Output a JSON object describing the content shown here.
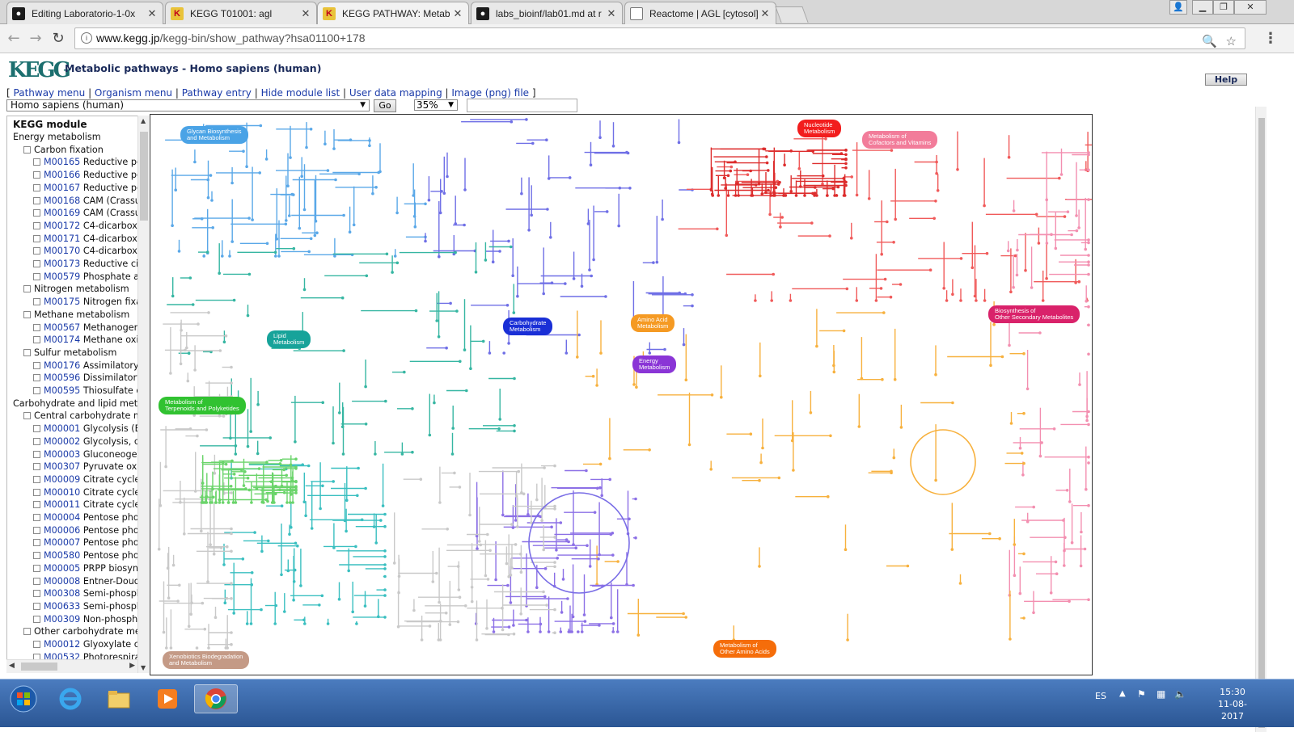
{
  "browser": {
    "tabs": [
      {
        "title": "Editing Laboratorio-1-0x",
        "icon": "github-icon"
      },
      {
        "title": "KEGG T01001: agl",
        "icon": "kegg-icon"
      },
      {
        "title": "KEGG PATHWAY: Metab",
        "icon": "kegg-icon",
        "active": true
      },
      {
        "title": "labs_bioinf/lab01.md at r",
        "icon": "github-icon"
      },
      {
        "title": "Reactome | AGL [cytosol]",
        "icon": "document-icon"
      }
    ],
    "url_host": "www.kegg.jp",
    "url_path": "/kegg-bin/show_pathway?hsa01100+178"
  },
  "page": {
    "title": "Metabolic pathways - Homo sapiens (human)",
    "logo_text": "KEGG",
    "menu_open": "[",
    "menu_links": [
      "Pathway menu",
      "Organism menu",
      "Pathway entry",
      "Hide module list",
      "User data mapping",
      "Image (png) file"
    ],
    "menu_close": "]",
    "help": "Help",
    "organism": "Homo sapiens (human)",
    "go": "Go",
    "zoom": "35%",
    "search_value": ""
  },
  "modules": {
    "header": "KEGG module",
    "items": [
      {
        "text": "Energy metabolism",
        "level": 0
      },
      {
        "text": "Carbon fixation",
        "level": 1
      },
      {
        "code": "M00165",
        "text": "Reductive pe",
        "level": 2
      },
      {
        "code": "M00166",
        "text": "Reductive pe",
        "level": 2
      },
      {
        "code": "M00167",
        "text": "Reductive pe",
        "level": 2
      },
      {
        "code": "M00168",
        "text": "CAM (Crassul",
        "level": 2
      },
      {
        "code": "M00169",
        "text": "CAM (Crassul",
        "level": 2
      },
      {
        "code": "M00172",
        "text": "C4-dicarboxy",
        "level": 2
      },
      {
        "code": "M00171",
        "text": "C4-dicarboxy",
        "level": 2
      },
      {
        "code": "M00170",
        "text": "C4-dicarboxy",
        "level": 2
      },
      {
        "code": "M00173",
        "text": "Reductive cit",
        "level": 2
      },
      {
        "code": "M00579",
        "text": "Phosphate ac",
        "level": 2
      },
      {
        "text": "Nitrogen metabolism",
        "level": 1
      },
      {
        "code": "M00175",
        "text": "Nitrogen fixat",
        "level": 2
      },
      {
        "text": "Methane metabolism",
        "level": 1
      },
      {
        "code": "M00567",
        "text": "Methanogene",
        "level": 2
      },
      {
        "code": "M00174",
        "text": "Methane oxid",
        "level": 2
      },
      {
        "text": "Sulfur metabolism",
        "level": 1
      },
      {
        "code": "M00176",
        "text": "Assimilatory :",
        "level": 2
      },
      {
        "code": "M00596",
        "text": "Dissimilatory",
        "level": 2
      },
      {
        "code": "M00595",
        "text": "Thiosulfate o:",
        "level": 2
      },
      {
        "text": "Carbohydrate and lipid metal",
        "level": 0
      },
      {
        "text": "Central carbohydrate m",
        "level": 1
      },
      {
        "code": "M00001",
        "text": "Glycolysis (Er",
        "level": 2
      },
      {
        "code": "M00002",
        "text": "Glycolysis, cc",
        "level": 2
      },
      {
        "code": "M00003",
        "text": "Gluconeogen",
        "level": 2
      },
      {
        "code": "M00307",
        "text": "Pyruvate oxic",
        "level": 2
      },
      {
        "code": "M00009",
        "text": "Citrate cycle",
        "level": 2
      },
      {
        "code": "M00010",
        "text": "Citrate cycle,",
        "level": 2
      },
      {
        "code": "M00011",
        "text": "Citrate cycle,",
        "level": 2
      },
      {
        "code": "M00004",
        "text": "Pentose phos",
        "level": 2
      },
      {
        "code": "M00006",
        "text": "Pentose phos",
        "level": 2
      },
      {
        "code": "M00007",
        "text": "Pentose phos",
        "level": 2
      },
      {
        "code": "M00580",
        "text": "Pentose phos",
        "level": 2
      },
      {
        "code": "M00005",
        "text": "PRPP biosyntl",
        "level": 2
      },
      {
        "code": "M00008",
        "text": "Entner-Doudc",
        "level": 2
      },
      {
        "code": "M00308",
        "text": "Semi-phosph",
        "level": 2
      },
      {
        "code": "M00633",
        "text": "Semi-phosph",
        "level": 2
      },
      {
        "code": "M00309",
        "text": "Non-phospho",
        "level": 2
      },
      {
        "text": "Other carbohydrate met",
        "level": 1
      },
      {
        "code": "M00012",
        "text": "Glyoxylate cy",
        "level": 2
      },
      {
        "code": "M00532",
        "text": "Photorespirat",
        "level": 2
      }
    ]
  },
  "map": {
    "categories": [
      {
        "name": "Glycan Biosynthesis\nand Metabolism",
        "color": "#4aa3e6"
      },
      {
        "name": "Nucleotide\nMetabolism",
        "color": "#f21d1d"
      },
      {
        "name": "Metabolism of\nCofactors and Vitamins",
        "color": "#f27c9a"
      },
      {
        "name": "Carbohydrate\nMetabolism",
        "color": "#1a2fd6"
      },
      {
        "name": "Amino Acid\nMetabolism",
        "color": "#f59a23"
      },
      {
        "name": "Lipid\nMetabolism",
        "color": "#17a39a"
      },
      {
        "name": "Energy\nMetabolism",
        "color": "#8a35d6"
      },
      {
        "name": "Biosynthesis of\nOther Secondary Metabolites",
        "color": "#d9226a"
      },
      {
        "name": "Metabolism of\nTerpenoids and Polyketides",
        "color": "#31c231"
      },
      {
        "name": "Xenobiotics Biodegradation\nand Metabolism",
        "color": "#c49a86"
      },
      {
        "name": "Metabolism of\nOther Amino Acids",
        "color": "#f56d0a"
      }
    ]
  },
  "taskbar": {
    "lang": "ES",
    "time": "15:30",
    "date": "11-08-2017"
  }
}
